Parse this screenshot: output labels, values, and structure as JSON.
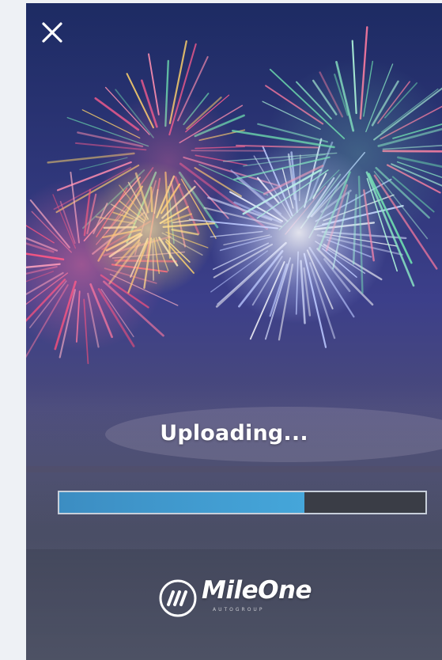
{
  "modal": {
    "close_icon": "close-icon",
    "status_text": "Uploading...",
    "progress": {
      "percent": 67
    },
    "logo": {
      "brand": "MileOne",
      "sub": "AUTOGROUP"
    }
  },
  "colors": {
    "progress_fill": "#45a6da",
    "progress_track": "#3a3d46",
    "text": "#ffffff"
  }
}
